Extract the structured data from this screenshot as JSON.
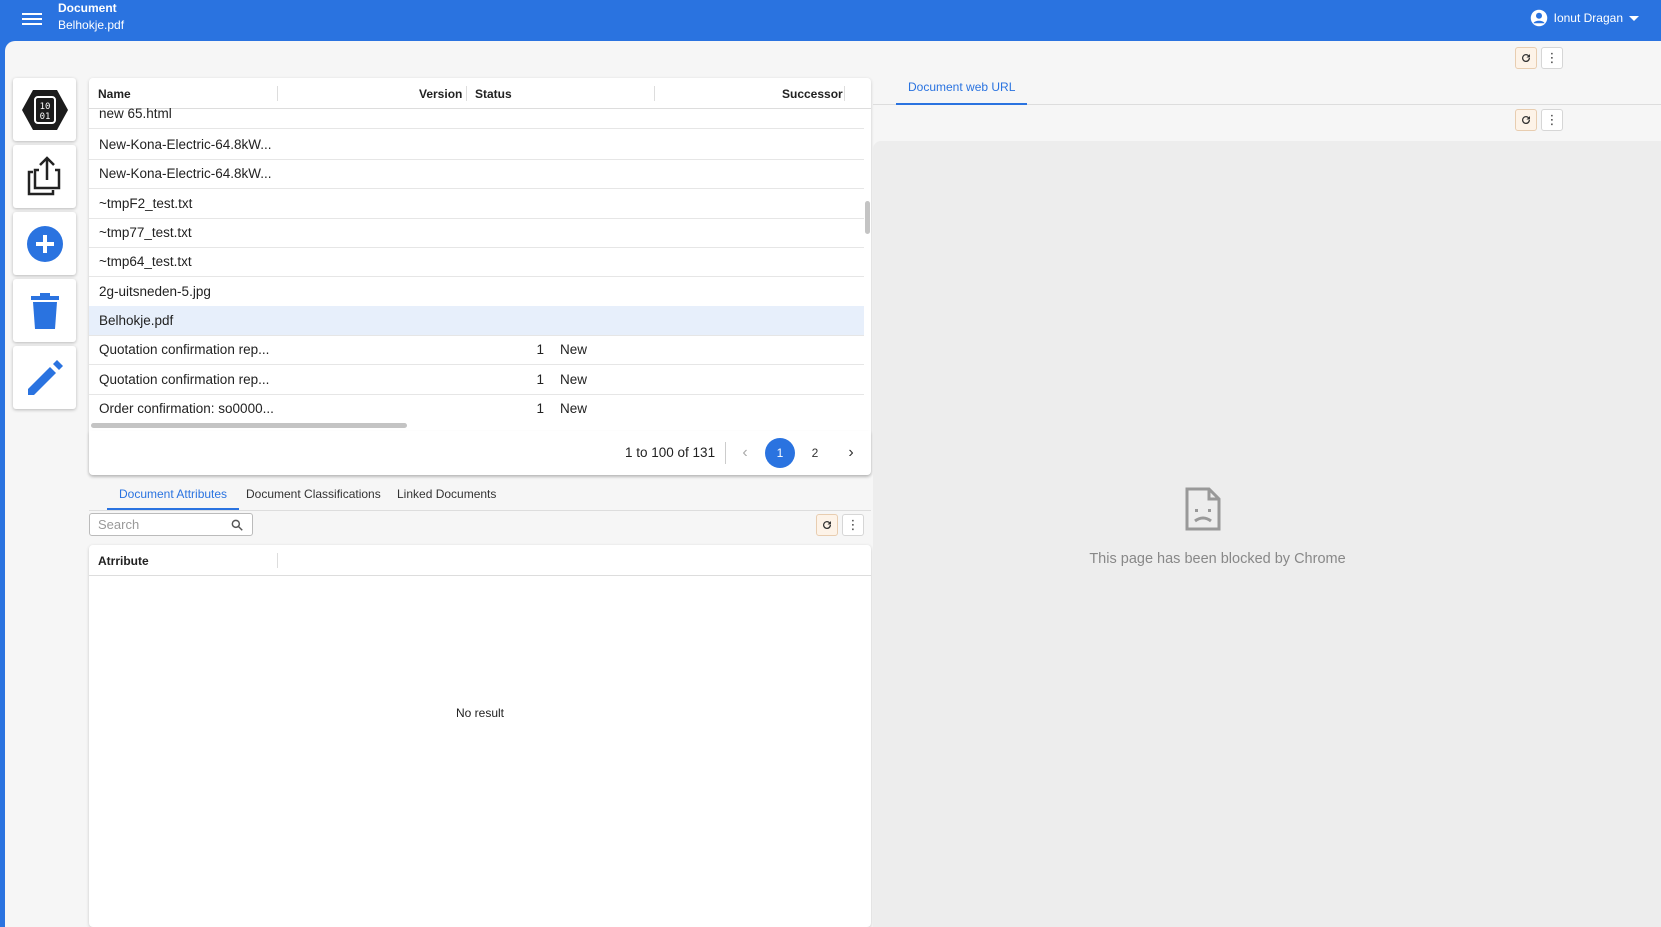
{
  "header": {
    "title": "Document",
    "subtitle": "Belhokje.pdf",
    "user_name": "Ionut Dragan"
  },
  "actions": [
    "binary-hex-icon",
    "share-upload-icon",
    "add-circle-icon",
    "trash-icon",
    "pencil-icon"
  ],
  "grid": {
    "columns": {
      "name": "Name",
      "version": "Version",
      "status": "Status",
      "successor": "Successor"
    },
    "rows": [
      {
        "name": "new 65.html",
        "version": "",
        "status": ""
      },
      {
        "name": "New-Kona-Electric-64.8kW...",
        "version": "",
        "status": ""
      },
      {
        "name": "New-Kona-Electric-64.8kW...",
        "version": "",
        "status": ""
      },
      {
        "name": "~tmpF2_test.txt",
        "version": "",
        "status": ""
      },
      {
        "name": "~tmp77_test.txt",
        "version": "",
        "status": ""
      },
      {
        "name": "~tmp64_test.txt",
        "version": "",
        "status": ""
      },
      {
        "name": "2g-uitsneden-5.jpg",
        "version": "",
        "status": ""
      },
      {
        "name": "Belhokje.pdf",
        "version": "",
        "status": "",
        "selected": true
      },
      {
        "name": "Quotation confirmation rep...",
        "version": "1",
        "status": "New"
      },
      {
        "name": "Quotation confirmation rep...",
        "version": "1",
        "status": "New"
      },
      {
        "name": "Order confirmation: so0000...",
        "version": "1",
        "status": "New"
      }
    ]
  },
  "pager": {
    "info": "1 to 100 of 131",
    "prev": "‹",
    "next": "›",
    "pages": [
      "1",
      "2"
    ]
  },
  "lower_tabs": [
    "Document Attributes",
    "Document Classifications",
    "Linked Documents"
  ],
  "search": {
    "placeholder": "Search",
    "value": ""
  },
  "attributes": {
    "column": "Atrribute",
    "empty_text": "No result"
  },
  "right_panel": {
    "tab": "Document web URL",
    "blocked_text": "This page has been blocked by Chrome"
  },
  "colors": {
    "primary": "#2a73e0",
    "selected_row": "#e7effb",
    "viewer_bg": "#ededed"
  }
}
